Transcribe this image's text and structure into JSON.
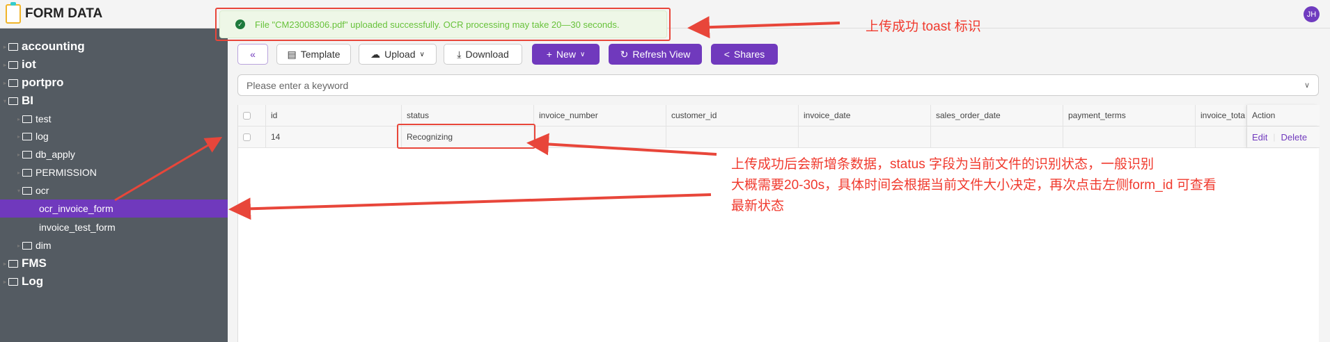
{
  "app": {
    "title": "FORM DATA",
    "user_initials": "JH"
  },
  "sidebar": {
    "items": [
      {
        "label": "accounting",
        "level": 0
      },
      {
        "label": "iot",
        "level": 0
      },
      {
        "label": "portpro",
        "level": 0
      },
      {
        "label": "BI",
        "level": 0,
        "expanded": true
      },
      {
        "label": "test",
        "level": 1
      },
      {
        "label": "log",
        "level": 1
      },
      {
        "label": "db_apply",
        "level": 1
      },
      {
        "label": "PERMISSION",
        "level": 1
      },
      {
        "label": "ocr",
        "level": 1,
        "expanded": true
      },
      {
        "label": "ocr_invoice_form",
        "level": 2,
        "active": true
      },
      {
        "label": "invoice_test_form",
        "level": 2
      },
      {
        "label": "dim",
        "level": 1
      },
      {
        "label": "FMS",
        "level": 0
      },
      {
        "label": "Log",
        "level": 0
      }
    ]
  },
  "toolbar": {
    "collapse": "«",
    "template": "Template",
    "upload": "Upload",
    "download": "Download",
    "new": "New",
    "refresh": "Refresh View",
    "shares": "Shares"
  },
  "search": {
    "placeholder": "Please enter a keyword"
  },
  "table": {
    "columns": [
      "id",
      "status",
      "invoice_number",
      "customer_id",
      "invoice_date",
      "sales_order_date",
      "payment_terms",
      "invoice_tota",
      "Action"
    ],
    "rows": [
      {
        "id": "14",
        "status": "Recognizing",
        "invoice_number": "",
        "customer_id": "",
        "invoice_date": "",
        "sales_order_date": "",
        "payment_terms": "",
        "invoice_total": ""
      }
    ],
    "actions": {
      "edit": "Edit",
      "delete": "Delete"
    }
  },
  "toast": {
    "message": "File \"CM23008306.pdf\" uploaded successfully. OCR processing may take 20—30 seconds.",
    "type": "success"
  },
  "annotations": {
    "toast_note": "上传成功 toast 标识",
    "row_note_lines": [
      "上传成功后会新增条数据，status 字段为当前文件的识别状态，一般识别",
      "大概需要20-30s，具体时间会根据当前文件大小决定，再次点击左侧form_id 可查看",
      "最新状态"
    ]
  },
  "colors": {
    "accent": "#7039bd",
    "sidebar_bg": "#545b62",
    "annotation": "#f03a2e",
    "success": "#67c23a"
  }
}
